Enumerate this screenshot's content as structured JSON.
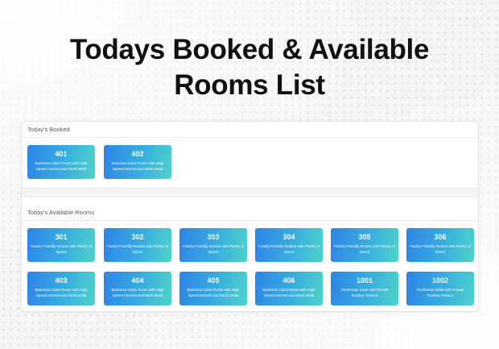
{
  "page": {
    "title_line1": "Todays Booked & Available",
    "title_line2": "Rooms List"
  },
  "booked": {
    "heading": "Today's Booked",
    "rooms": [
      {
        "number": "401",
        "desc": "Business Class Room with High Speed Internet and Work Desk"
      },
      {
        "number": "402",
        "desc": "Business Class Room with High Speed Internet and Work Desk"
      }
    ]
  },
  "available": {
    "heading": "Today's Available Rooms",
    "rooms": [
      {
        "number": "301",
        "desc": "Family-Friendly Rooms with Plenty of Space"
      },
      {
        "number": "302",
        "desc": "Family-Friendly Rooms with Plenty of Space"
      },
      {
        "number": "303",
        "desc": "Family-Friendly Rooms with Plenty of Space"
      },
      {
        "number": "304",
        "desc": "Family-Friendly Rooms with Plenty of Space"
      },
      {
        "number": "305",
        "desc": "Family-Friendly Rooms with Plenty of Space"
      },
      {
        "number": "306",
        "desc": "Family-Friendly Rooms with Plenty of Space"
      },
      {
        "number": "403",
        "desc": "Business Class Room with High Speed Internet and Work Desk"
      },
      {
        "number": "404",
        "desc": "Business Class Room with High Speed Internet and Work Desk"
      },
      {
        "number": "405",
        "desc": "Business Class Room with High Speed Internet and Work Desk"
      },
      {
        "number": "406",
        "desc": "Business Class Room with High Speed Internet and Work Desk"
      },
      {
        "number": "1001",
        "desc": "Penthouse Suite with Private Rooftop Terrace"
      },
      {
        "number": "1002",
        "desc": "Penthouse Suite with Private Rooftop Terrace"
      }
    ]
  },
  "colors": {
    "card_start": "#2d84e6",
    "card_end": "#4fd3c8"
  }
}
